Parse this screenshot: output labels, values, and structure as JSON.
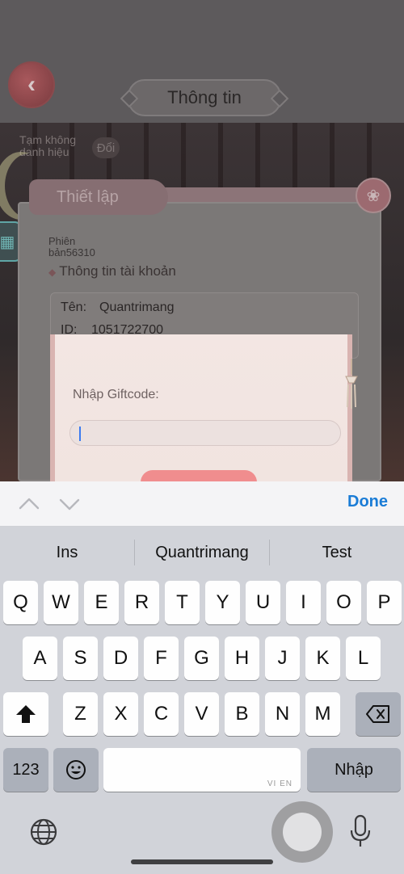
{
  "game": {
    "title": "Thông tin",
    "back_icon": "chevron-left-icon",
    "status_text": "Tạm không danh hiệu",
    "change_label": "Đổi",
    "panel": {
      "tab_label": "Thiết lập",
      "close_icon": "flower-close-icon",
      "version_text": "Phiên bản56310",
      "section_title": "Thông tin tài khoản",
      "name_label": "Tên:",
      "name_value": "Quantrimang",
      "id_label": "ID:",
      "id_value": "1051722700"
    },
    "gift_dialog": {
      "label": "Nhập Giftcode:",
      "input_value": ""
    }
  },
  "accessory": {
    "done_label": "Done",
    "prev_icon": "chevron-up-icon",
    "next_icon": "chevron-down-icon"
  },
  "keyboard": {
    "suggestions": [
      "Ins",
      "Quantrimang",
      "Test"
    ],
    "row1": [
      "Q",
      "W",
      "E",
      "R",
      "T",
      "Y",
      "U",
      "I",
      "O",
      "P"
    ],
    "row2": [
      "A",
      "S",
      "D",
      "F",
      "G",
      "H",
      "J",
      "K",
      "L"
    ],
    "row3": [
      "Z",
      "X",
      "C",
      "V",
      "B",
      "N",
      "M"
    ],
    "numbers_label": "123",
    "space_mark": "VI EN",
    "return_label": "Nhập",
    "icons": {
      "shift": "shift-icon",
      "backspace": "backspace-icon",
      "emoji": "emoji-icon",
      "globe": "globe-icon",
      "mic": "microphone-icon"
    }
  },
  "colors": {
    "accent_blue": "#1a7cd6",
    "dialog_bg": "#f3e6e3",
    "keyboard_bg": "#d1d3d9"
  }
}
